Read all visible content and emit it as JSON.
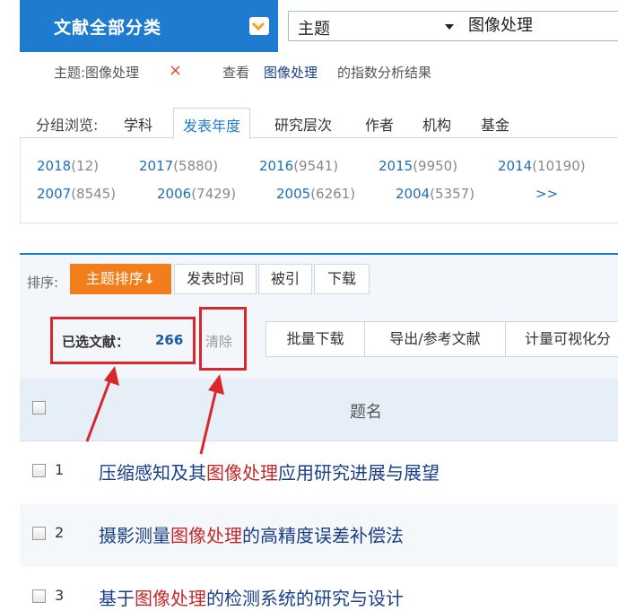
{
  "topbar": {
    "category_label": "文献全部分类",
    "field_value": "主题",
    "search_value": "图像处理"
  },
  "filter": {
    "tag": "主题:图像处理",
    "remove": "×",
    "view_label": "查看",
    "keyword": "图像处理",
    "result_label": "的指数分析结果"
  },
  "group": {
    "label": "分组浏览:",
    "tabs": [
      "学科",
      "发表年度",
      "研究层次",
      "作者",
      "机构",
      "基金"
    ],
    "active_tab": "发表年度",
    "years": [
      {
        "year": "2018",
        "count": "(12)"
      },
      {
        "year": "2017",
        "count": "(5880)"
      },
      {
        "year": "2016",
        "count": "(9541)"
      },
      {
        "year": "2015",
        "count": "(9950)"
      },
      {
        "year": "2014",
        "count": "(10190)"
      },
      {
        "year": "2007",
        "count": "(8545)"
      },
      {
        "year": "2006",
        "count": "(7429)"
      },
      {
        "year": "2005",
        "count": "(6261)"
      },
      {
        "year": "2004",
        "count": "(5357)"
      }
    ],
    "more": ">>"
  },
  "sort": {
    "label": "排序:",
    "options": [
      "主题排序",
      "发表时间",
      "被引",
      "下载"
    ],
    "active_arrow": "↓"
  },
  "selection": {
    "selected_label": "已选文献：",
    "selected_count": "266",
    "clear": "清除",
    "actions": [
      "批量下载",
      "导出/参考文献",
      "计量可视化分"
    ]
  },
  "table": {
    "header_title": "题名",
    "rows": [
      {
        "num": "1",
        "pre": "压缩感知及其",
        "hl": "图像处理",
        "post": "应用研究进展与展望"
      },
      {
        "num": "2",
        "pre": "摄影测量",
        "hl": "图像处理",
        "post": "的高精度误差补偿法"
      },
      {
        "num": "3",
        "pre": "基于",
        "hl": "图像处理",
        "post": "的检测系统的研究与设计"
      }
    ]
  },
  "colors": {
    "brand_blue": "#1e7bd0",
    "sort_active": "#f27d1b",
    "highlight_red": "#c4282c",
    "annotation_red": "#d8282d"
  }
}
